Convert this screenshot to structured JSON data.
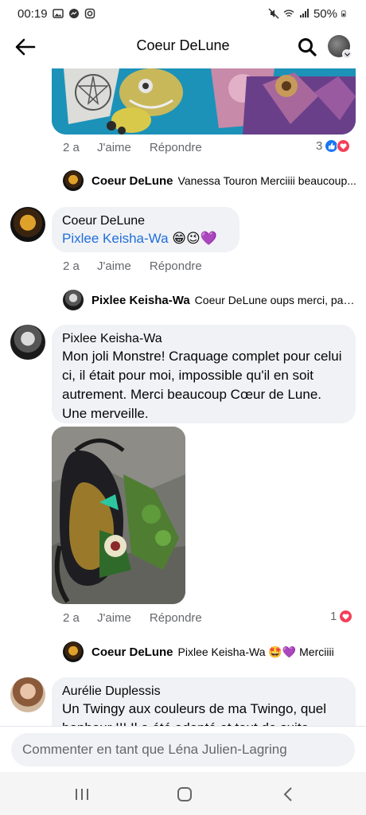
{
  "status_bar": {
    "time": "00:19",
    "battery": "50%"
  },
  "header": {
    "title": "Coeur DeLune"
  },
  "thread": [
    {
      "time": "2 a",
      "like_label": "J'aime",
      "reply_label": "Répondre",
      "reaction_count": "3"
    },
    {
      "reply_preview": {
        "name": "Coeur DeLune",
        "text": "Vanessa Touron Merciiii beaucoup..."
      }
    },
    {
      "author": "Coeur DeLune",
      "mention": "Pixlee Keisha-Wa",
      "emoji": "😁😉💜",
      "time": "2 a",
      "like_label": "J'aime",
      "reply_label": "Répondre"
    },
    {
      "reply_preview": {
        "name": "Pixlee Keisha-Wa",
        "text": "Coeur DeLune oups merci, par ..."
      }
    },
    {
      "author": "Pixlee Keisha-Wa",
      "text": "Mon joli Monstre! Craquage complet pour celui ci, il était pour moi, impossible qu'il en soit autrement. Merci beaucoup Cœur de Lune. Une merveille.",
      "time": "2 a",
      "like_label": "J'aime",
      "reply_label": "Répondre",
      "reaction_count": "1"
    },
    {
      "reply_preview": {
        "name": "Coeur DeLune",
        "text": "Pixlee Keisha-Wa 🤩💜 Merciiii"
      }
    },
    {
      "author": "Aurélie Duplessis",
      "text": "Un Twingy aux couleurs de ma Twingo, quel bonheur !!! Il a été adopté et tout de suite"
    }
  ],
  "composer": {
    "placeholder": "Commenter en tant que Léna Julien-Lagring"
  },
  "colors": {
    "link": "#216fdb",
    "like_blue": "#1877f2",
    "love_red": "#f33e58",
    "bubble_bg": "#f0f2f5",
    "meta_gray": "#65676b"
  },
  "icons": [
    "back-arrow-icon",
    "search-icon",
    "like-reaction-icon",
    "love-reaction-icon",
    "recents-icon",
    "home-icon",
    "back-nav-icon"
  ]
}
